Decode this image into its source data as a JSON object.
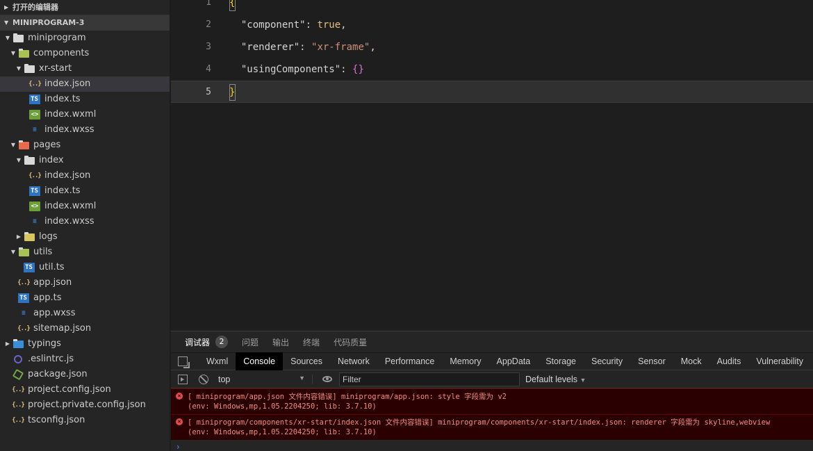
{
  "explorer": {
    "open_editors_label": "打开的编辑器",
    "project_label": "MINIPROGRAM-3",
    "tree": [
      {
        "label": "miniprogram",
        "level": 1,
        "type": "folder",
        "expanded": true,
        "color": "#d8d8d8"
      },
      {
        "label": "components",
        "level": 2,
        "type": "folder",
        "expanded": true,
        "color": "#a8c256"
      },
      {
        "label": "xr-start",
        "level": 3,
        "type": "folder",
        "expanded": true,
        "color": "#d8d8d8"
      },
      {
        "label": "index.json",
        "level": 4,
        "type": "json",
        "selected": true
      },
      {
        "label": "index.ts",
        "level": 4,
        "type": "ts"
      },
      {
        "label": "index.wxml",
        "level": 4,
        "type": "wxml"
      },
      {
        "label": "index.wxss",
        "level": 4,
        "type": "wxss"
      },
      {
        "label": "pages",
        "level": 2,
        "type": "folder",
        "expanded": true,
        "color": "#e96a4c"
      },
      {
        "label": "index",
        "level": 3,
        "type": "folder",
        "expanded": true,
        "color": "#d8d8d8"
      },
      {
        "label": "index.json",
        "level": 4,
        "type": "json"
      },
      {
        "label": "index.ts",
        "level": 4,
        "type": "ts"
      },
      {
        "label": "index.wxml",
        "level": 4,
        "type": "wxml"
      },
      {
        "label": "index.wxss",
        "level": 4,
        "type": "wxss"
      },
      {
        "label": "logs",
        "level": 3,
        "type": "folder",
        "expanded": false,
        "color": "#d9c45f"
      },
      {
        "label": "utils",
        "level": 2,
        "type": "folder",
        "expanded": true,
        "color": "#a8c256"
      },
      {
        "label": "util.ts",
        "level": 3,
        "type": "ts"
      },
      {
        "label": "app.json",
        "level": 2,
        "type": "json"
      },
      {
        "label": "app.ts",
        "level": 2,
        "type": "ts"
      },
      {
        "label": "app.wxss",
        "level": 2,
        "type": "wxss"
      },
      {
        "label": "sitemap.json",
        "level": 2,
        "type": "json"
      },
      {
        "label": "typings",
        "level": 1,
        "type": "folder",
        "expanded": false,
        "color": "#3a8ed8"
      },
      {
        "label": ".eslintrc.js",
        "level": 1,
        "type": "eslint"
      },
      {
        "label": "package.json",
        "level": 1,
        "type": "pkg"
      },
      {
        "label": "project.config.json",
        "level": 1,
        "type": "json"
      },
      {
        "label": "project.private.config.json",
        "level": 1,
        "type": "json"
      },
      {
        "label": "tsconfig.json",
        "level": 1,
        "type": "json"
      }
    ]
  },
  "editor": {
    "current_line": 5,
    "lines": [
      {
        "num": "1",
        "tokens": [
          {
            "t": "{",
            "c": "brace-y"
          }
        ]
      },
      {
        "num": "2",
        "tokens": [
          {
            "t": "  ",
            "c": ""
          },
          {
            "t": "\"component\"",
            "c": "json-key"
          },
          {
            "t": ": ",
            "c": ""
          },
          {
            "t": "true",
            "c": "kw"
          },
          {
            "t": ",",
            "c": ""
          }
        ]
      },
      {
        "num": "3",
        "tokens": [
          {
            "t": "  ",
            "c": ""
          },
          {
            "t": "\"renderer\"",
            "c": "json-key"
          },
          {
            "t": ": ",
            "c": ""
          },
          {
            "t": "\"xr-frame\"",
            "c": "str-val"
          },
          {
            "t": ",",
            "c": ""
          }
        ]
      },
      {
        "num": "4",
        "tokens": [
          {
            "t": "  ",
            "c": ""
          },
          {
            "t": "\"usingComponents\"",
            "c": "json-key"
          },
          {
            "t": ": ",
            "c": ""
          },
          {
            "t": "{}",
            "c": "brace-p"
          }
        ]
      },
      {
        "num": "5",
        "tokens": [
          {
            "t": "}",
            "c": "brace-y"
          }
        ]
      }
    ]
  },
  "panel": {
    "tabs": [
      {
        "label": "调试器",
        "active": true,
        "badge": "2"
      },
      {
        "label": "问题"
      },
      {
        "label": "输出"
      },
      {
        "label": "终端"
      },
      {
        "label": "代码质量"
      }
    ],
    "devtools_tabs": [
      "Wxml",
      "Console",
      "Sources",
      "Network",
      "Performance",
      "Memory",
      "AppData",
      "Storage",
      "Security",
      "Sensor",
      "Mock",
      "Audits",
      "Vulnerability"
    ],
    "devtools_active": "Console",
    "context": "top",
    "filter_placeholder": "Filter",
    "levels_label": "Default levels",
    "messages": [
      {
        "line1": "[ miniprogram/app.json 文件内容错误] miniprogram/app.json: style 字段需为 v2",
        "line2": "(env: Windows,mp,1.05.2204250; lib: 3.7.10)"
      },
      {
        "line1": "[ miniprogram/components/xr-start/index.json 文件内容错误] miniprogram/components/xr-start/index.json: renderer 字段需为 skyline,webview",
        "line2": "(env: Windows,mp,1.05.2204250; lib: 3.7.10)"
      }
    ],
    "prompt_symbol": "›"
  }
}
